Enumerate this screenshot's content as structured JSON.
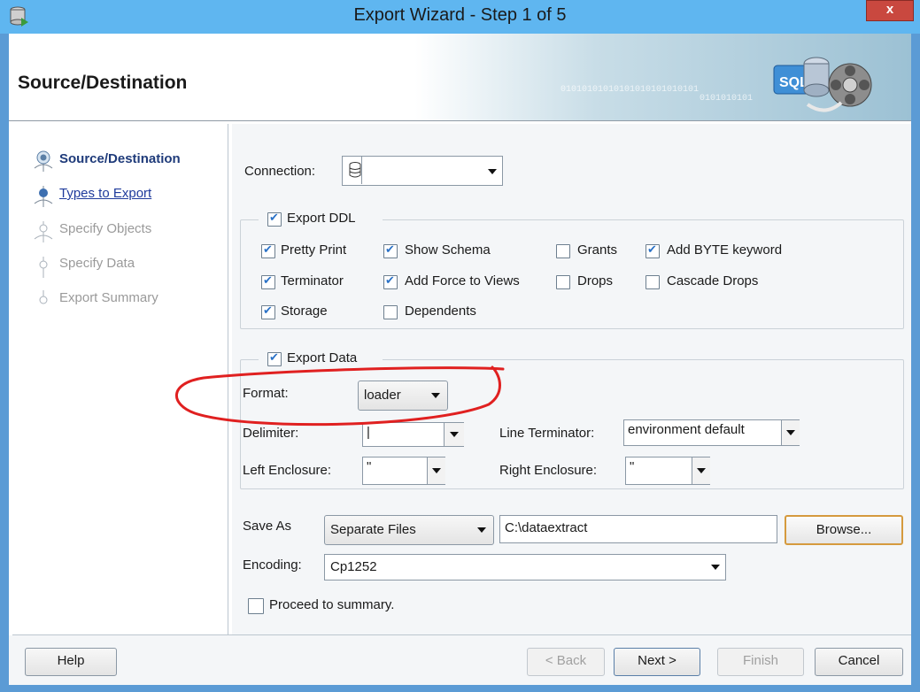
{
  "window": {
    "title": "Export Wizard - Step 1 of 5",
    "close_label": "x"
  },
  "header": {
    "title": "Source/Destination",
    "binary_line1": "01010101010101010101010101",
    "binary_line2": "0101010101"
  },
  "steps": [
    {
      "label": "Source/Destination",
      "state": "current"
    },
    {
      "label": "Types to Export",
      "state": "link"
    },
    {
      "label": "Specify Objects",
      "state": "disabled"
    },
    {
      "label": "Specify Data",
      "state": "disabled"
    },
    {
      "label": "Export Summary",
      "state": "disabled"
    }
  ],
  "connection": {
    "label": "Connection:",
    "value": ""
  },
  "export_ddl": {
    "label": "Export DDL",
    "checked": true,
    "options": {
      "pretty_print": {
        "label": "Pretty Print",
        "checked": true
      },
      "show_schema": {
        "label": "Show Schema",
        "checked": true
      },
      "grants": {
        "label": "Grants",
        "checked": false
      },
      "add_byte": {
        "label": "Add BYTE keyword",
        "checked": true
      },
      "terminator": {
        "label": "Terminator",
        "checked": true
      },
      "add_force": {
        "label": "Add Force to Views",
        "checked": true
      },
      "drops": {
        "label": "Drops",
        "checked": false
      },
      "cascade_drops": {
        "label": "Cascade Drops",
        "checked": false
      },
      "storage": {
        "label": "Storage",
        "checked": true
      },
      "dependents": {
        "label": "Dependents",
        "checked": false
      }
    }
  },
  "export_data": {
    "label": "Export Data",
    "checked": true,
    "format_label": "Format:",
    "format_value": "loader",
    "delimiter_label": "Delimiter:",
    "delimiter_value": "|",
    "line_terminator_label": "Line Terminator:",
    "line_terminator_value": "environment default",
    "left_enclosure_label": "Left Enclosure:",
    "left_enclosure_value": "\"",
    "right_enclosure_label": "Right Enclosure:",
    "right_enclosure_value": "\""
  },
  "save_as": {
    "label": "Save As",
    "value": "Separate Files",
    "path": "C:\\dataextract",
    "browse_label": "Browse..."
  },
  "encoding": {
    "label": "Encoding:",
    "value": "Cp1252"
  },
  "proceed": {
    "label": "Proceed to summary.",
    "checked": false
  },
  "footer": {
    "help": "Help",
    "back": "< Back",
    "next": "Next >",
    "finish": "Finish",
    "cancel": "Cancel"
  },
  "annotation": {
    "color": "#e02020"
  }
}
